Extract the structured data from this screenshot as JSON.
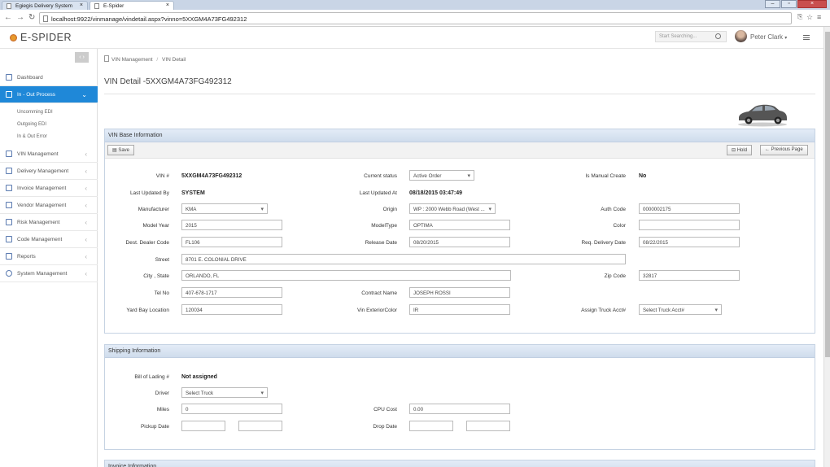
{
  "browser": {
    "tabs": [
      {
        "label": "Egiegis Delivery System"
      },
      {
        "label": "E-Spider"
      }
    ],
    "url": "localhost:9922/vinmanage/vindetail.aspx?vinno=5XXGM4A73FG492312"
  },
  "app": {
    "logo": "E-SPIDER",
    "search_placeholder": "Start Searching...",
    "user": "Peter Clark"
  },
  "sidebar": {
    "items": [
      {
        "label": "Dashboard"
      },
      {
        "label": "In - Out Process"
      },
      {
        "label": "VIN Management"
      },
      {
        "label": "Delivery Management"
      },
      {
        "label": "Invoice Management"
      },
      {
        "label": "Vendor Management"
      },
      {
        "label": "Risk Management"
      },
      {
        "label": "Code Management"
      },
      {
        "label": "Reports"
      },
      {
        "label": "System Management"
      }
    ],
    "subitems": [
      "Uncomming EDI",
      "Outgoing EDI",
      "In & Out Error"
    ]
  },
  "breadcrumb": {
    "parent": "VIN Management",
    "separator": "/",
    "current": "VIN Detail"
  },
  "page": {
    "title": "VIN Detail -5XXGM4A73FG492312"
  },
  "base": {
    "header": "VIN Base Information",
    "buttons": {
      "save": "Save",
      "hold": "Hold",
      "prev": "Previous Page"
    },
    "labels": {
      "vin": "VIN #",
      "current_status": "Current status",
      "manual": "Is Manual Create",
      "last_by": "Last Updated By",
      "last_at": "Last Updated At",
      "manufacturer": "Manufacturer",
      "origin": "Origin",
      "auth": "Auth Code",
      "model_year": "Model Year",
      "model_type": "ModelType",
      "color": "Color",
      "dealer": "Dest. Dealer Code",
      "release": "Release Date",
      "req_delivery": "Req. Delivery Date",
      "street": "Street",
      "city": "City , State",
      "zip": "Zip Code",
      "tel": "Tel No",
      "contract": "Contract Name",
      "yard": "Yard Bay Location",
      "ext_color": "Vin ExteriorColor",
      "truck": "Assign Truck Acct#"
    },
    "values": {
      "vin": "5XXGM4A73FG492312",
      "current_status": "Active Order",
      "manual": "No",
      "last_by": "SYSTEM",
      "last_at": "08/18/2015 03:47:49",
      "manufacturer": "KMA",
      "origin": "WP : 2000 Webb Road (West ...",
      "auth": "0000002175",
      "model_year": "2015",
      "model_type": "OPTIMA",
      "color": "",
      "dealer": "FL106",
      "release": "08/20/2015",
      "req_delivery": "08/22/2015",
      "street": "8701 E. COLONIAL DRIVE",
      "city": "ORLANDO, FL",
      "zip": "32817",
      "tel": "407-678-1717",
      "contract": "JOSEPH ROSSI",
      "yard": "120034",
      "ext_color": "IR",
      "truck": "Select Truck Acct#"
    }
  },
  "shipping": {
    "header": "Shipping Information",
    "labels": {
      "bol": "Bill of Lading #",
      "driver": "Driver",
      "miles": "Miles",
      "cpu": "CPU Cost",
      "pickup": "Pickup Date",
      "drop": "Drop Date"
    },
    "values": {
      "bol": "Not assigned",
      "driver": "Select Truck",
      "miles": "0",
      "cpu": "0.00",
      "pickup_from": "",
      "pickup_to": "",
      "drop_from": "",
      "drop_to": ""
    }
  },
  "invoice": {
    "header": "Invoice Information"
  }
}
